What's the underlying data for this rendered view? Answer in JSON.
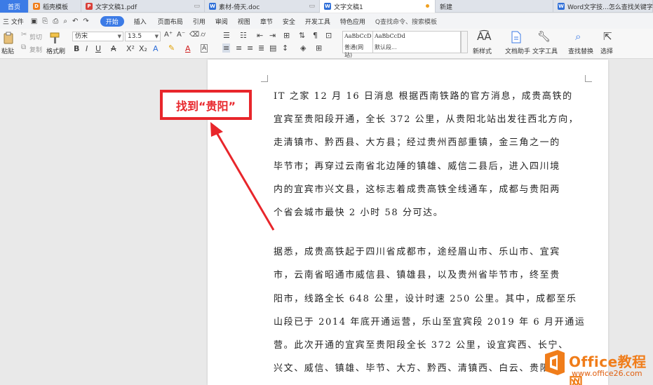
{
  "tabs": [
    {
      "label": "首页"
    },
    {
      "label": "稻壳模板"
    },
    {
      "label": "文字文稿1.pdf"
    },
    {
      "label": "素材-倚天.doc"
    },
    {
      "label": "文字文稿1"
    },
    {
      "label": "新建"
    },
    {
      "label": "Word文字技...怎么查找关键字"
    }
  ],
  "menu": {
    "file": "三 文件",
    "items": [
      "开始",
      "插入",
      "页面布局",
      "引用",
      "审阅",
      "视图",
      "章节",
      "安全",
      "开发工具",
      "特色应用"
    ],
    "search": "Q查找命令、搜索模板"
  },
  "ribbon": {
    "paste": "粘贴",
    "cut": "剪切",
    "copy": "复制",
    "format_painter": "格式刷",
    "font_name": "仿宋",
    "font_size": "13.5",
    "style1_preview": "AaBbCcD",
    "style1_label": "普通(网站)",
    "style2_preview": "AaBbCcDd",
    "style2_label": "默认段...",
    "new_style": "新样式",
    "doc_helper": "文档助手",
    "text_tools": "文字工具",
    "find_replace": "查找替换",
    "select": "选择"
  },
  "annotation": {
    "callout": "找到“贵阳”",
    "color": "#e8262b"
  },
  "document": {
    "lines": [
      "IT 之家 12 月 16 日消息  根据西南铁路的官方消息，成贵高铁的",
      "宜宾至贵阳段开通，全长 372 公里，从贵阳北站出发往西北方向，",
      "走清镇市、黔西县、大方县；经过贵州西部重镇，金三角之一的",
      "毕节市；再穿过云南省北边陲的镇雄、威信二县后，进入四川境",
      "内的宜宾市兴文县，这标志着成贵高铁全线通车，成都与贵阳两",
      "个省会城市最快 2 小时 58 分可达。",
      "据悉，成贵高铁起于四川省成都市，途经眉山市、乐山市、宜宾",
      "市，云南省昭通市威信县、镇雄县，以及贵州省毕节市，终至贵",
      "阳市，线路全长 648 公里，设计时速 250 公里。其中，成都至乐",
      "山段已于 2014 年底开通运营，乐山至宜宾段 2019 年 6 月开通运",
      "营。此次开通的宜宾至贵阳段全长 372 公里，设宜宾西、长宁、",
      "兴文、威信、镇雄、毕节、大方、黔西、清镇西、白云、贵阳"
    ]
  },
  "watermark": {
    "brand": "Office教程网",
    "url": "www.office26.com"
  },
  "colors": {
    "accent_blue": "#3c7be6",
    "brand_orange": "#f07d1a"
  }
}
